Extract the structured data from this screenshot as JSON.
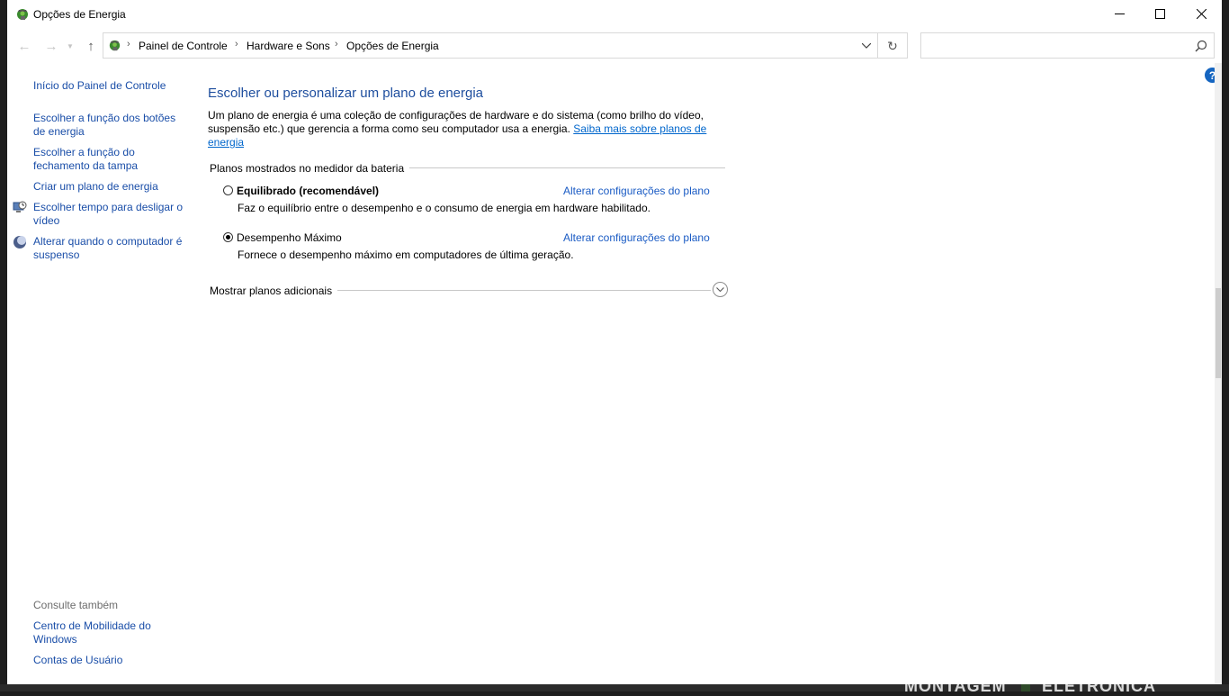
{
  "window": {
    "title": "Opções de Energia"
  },
  "address": {
    "breadcrumbs": [
      "Painel de Controle",
      "Hardware e Sons",
      "Opções de Energia"
    ],
    "search_placeholder": ""
  },
  "sidebar": {
    "links": [
      {
        "label": "Início do Painel de Controle",
        "icon": null
      },
      {
        "label": "Escolher a função dos botões de energia",
        "icon": null
      },
      {
        "label": "Escolher a função do fechamento da tampa",
        "icon": null
      },
      {
        "label": "Criar um plano de energia",
        "icon": null
      },
      {
        "label": "Escolher tempo para desligar o vídeo",
        "icon": "monitor-clock-icon"
      },
      {
        "label": "Alterar quando o computador é suspenso",
        "icon": "moon-icon"
      }
    ],
    "see_also_heading": "Consulte também",
    "see_also": [
      {
        "label": "Centro de Mobilidade do Windows"
      },
      {
        "label": "Contas de Usuário"
      }
    ]
  },
  "main": {
    "title": "Escolher ou personalizar um plano de energia",
    "intro_text": "Um plano de energia é uma coleção de configurações de hardware e do sistema (como brilho do vídeo, suspensão etc.) que gerencia a forma como seu computador usa a energia.",
    "intro_link": "Saiba mais sobre planos de energia",
    "group_label": "Planos mostrados no medidor da bateria",
    "plans": [
      {
        "name": "Equilibrado (recomendável)",
        "selected": false,
        "description": "Faz o equilíbrio entre o desempenho e o consumo de energia em hardware habilitado.",
        "link": "Alterar configurações do plano"
      },
      {
        "name": "Desempenho Máximo",
        "selected": true,
        "description": "Fornece o desempenho máximo em computadores de última geração.",
        "link": "Alterar configurações do plano"
      }
    ],
    "more_plans_label": "Mostrar planos adicionais"
  },
  "desktop": {
    "bg_text_1": "MONTAGEM",
    "bg_text_2": "ELETRONICA"
  },
  "colors": {
    "link": "#1a4ea8",
    "title": "#1e4e9e",
    "help": "#1565c0"
  }
}
